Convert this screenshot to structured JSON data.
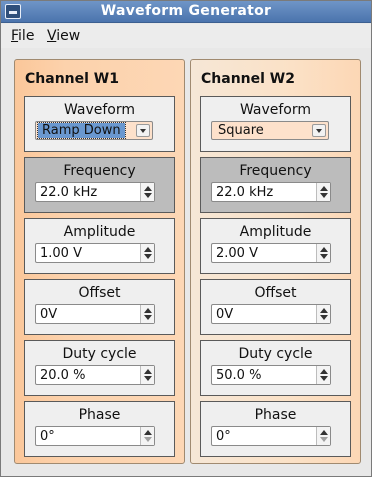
{
  "window": {
    "title": "Waveform Generator"
  },
  "menu": {
    "file": "File",
    "view": "View"
  },
  "channels": [
    {
      "title": "Channel W1",
      "waveform": {
        "label": "Waveform",
        "value": "Ramp Down"
      },
      "frequency": {
        "label": "Frequency",
        "value": "22.0 kHz"
      },
      "amplitude": {
        "label": "Amplitude",
        "value": "1.00 V"
      },
      "offset": {
        "label": "Offset",
        "value": "0V"
      },
      "duty_cycle": {
        "label": "Duty cycle",
        "value": "20.0 %"
      },
      "phase": {
        "label": "Phase",
        "value": "0°"
      }
    },
    {
      "title": "Channel W2",
      "waveform": {
        "label": "Waveform",
        "value": "Square"
      },
      "frequency": {
        "label": "Frequency",
        "value": "22.0 kHz"
      },
      "amplitude": {
        "label": "Amplitude",
        "value": "2.00 V"
      },
      "offset": {
        "label": "Offset",
        "value": "0V"
      },
      "duty_cycle": {
        "label": "Duty cycle",
        "value": "50.0 %"
      },
      "phase": {
        "label": "Phase",
        "value": "0°"
      }
    }
  ],
  "icons": {
    "system_menu": "window-menu-icon",
    "spin": "spin-arrows-icon",
    "dropdown": "chevron-down-icon"
  }
}
